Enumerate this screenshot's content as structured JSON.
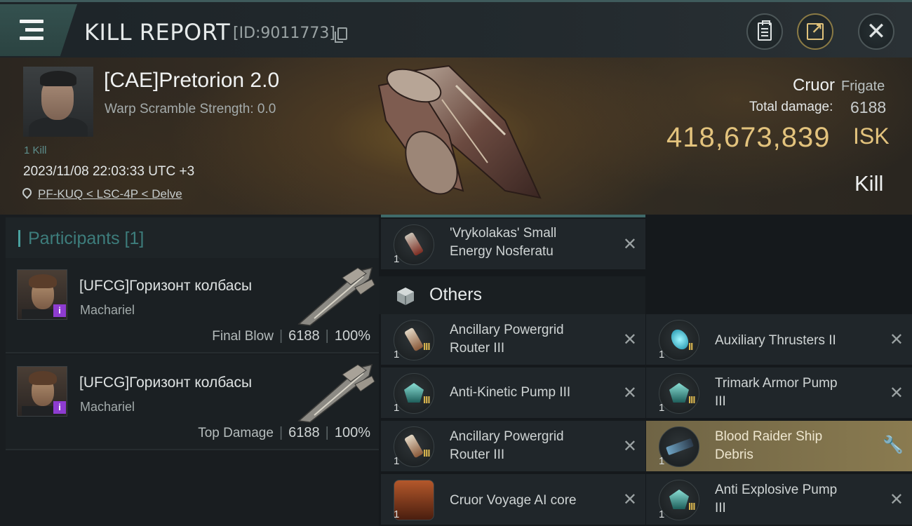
{
  "header": {
    "title": "KILL REPORT",
    "report_id": "[ID:9011773]"
  },
  "victim": {
    "name": "[CAE]Pretorion 2.0",
    "warp_scramble": "Warp Scramble Strength: 0.0",
    "kill_count": "1 Kill",
    "datetime": "2023/11/08 22:03:33 UTC +3",
    "location": "PF-KUQ < LSC-4P < Delve",
    "ship_name": "Cruor",
    "ship_class": "Frigate",
    "total_damage_label": "Total damage:",
    "total_damage_value": "6188",
    "isk_value": "418,673,839",
    "isk_unit": "ISK",
    "result": "Kill"
  },
  "participants": {
    "title": "Participants [1]",
    "items": [
      {
        "name": "[UFCG]Горизонт колбасы",
        "ship": "Machariel",
        "stat_label": "Final Blow",
        "damage": "6188",
        "percent": "100%"
      },
      {
        "name": "[UFCG]Горизонт колбасы",
        "ship": "Machariel",
        "stat_label": "Top Damage",
        "damage": "6188",
        "percent": "100%"
      }
    ]
  },
  "modules": {
    "top_slot": {
      "qty": "1",
      "line1": "'Vrykolakas' Small",
      "line2": "Energy Nosferatu"
    },
    "others_title": "Others",
    "left": [
      {
        "qty": "1",
        "meta": "III",
        "line1": "Ancillary Powergrid",
        "line2": "Router III"
      },
      {
        "qty": "1",
        "meta": "III",
        "line1": "Anti-Kinetic Pump III",
        "line2": ""
      },
      {
        "qty": "1",
        "meta": "III",
        "line1": "Ancillary Powergrid",
        "line2": "Router III"
      },
      {
        "qty": "1",
        "meta": "",
        "line1": "Cruor Voyage AI core",
        "line2": ""
      }
    ],
    "right": [
      {
        "qty": "1",
        "meta": "II",
        "line1": "Auxiliary Thrusters II",
        "line2": ""
      },
      {
        "qty": "1",
        "meta": "III",
        "line1": "Trimark Armor Pump",
        "line2": "III"
      },
      {
        "qty": "1",
        "meta": "",
        "line1": "Blood Raider Ship",
        "line2": "Debris"
      },
      {
        "qty": "1",
        "meta": "III",
        "line1": "Anti  Explosive Pump",
        "line2": "III"
      }
    ],
    "close_glyph": "✕"
  },
  "colors": {
    "accent_teal": "#4aa2a0",
    "isk_gold": "#e3c37d",
    "highlight_row": "#8a7b50",
    "info_badge": "#8e3cd0"
  }
}
